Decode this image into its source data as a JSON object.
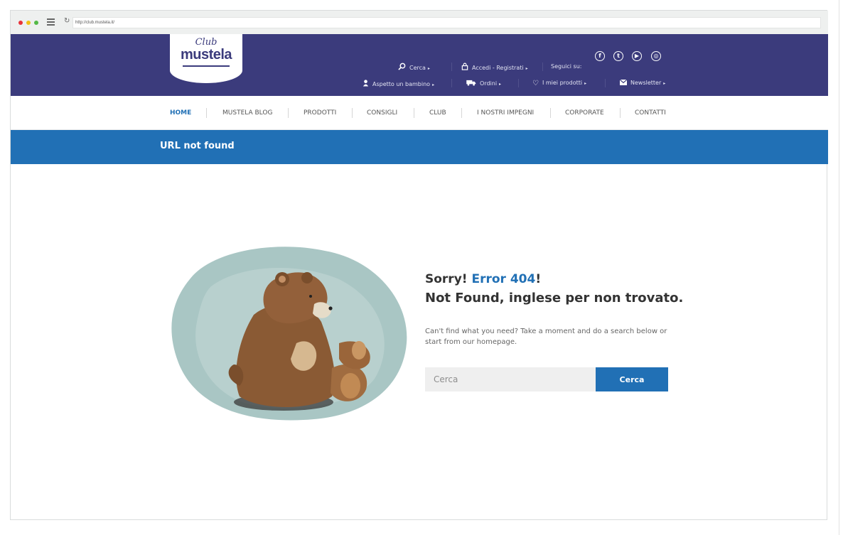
{
  "browser": {
    "url": "http://club.mustela.it/"
  },
  "logo": {
    "club": "Club",
    "name": "mustela"
  },
  "header": {
    "search_label": "Cerca",
    "login_label": "Accedi - Registrati",
    "follow_label": "Seguici su:",
    "expecting_label": "Aspetto un bambino",
    "orders_label": "Ordini",
    "my_products_label": "I miei prodotti",
    "newsletter_label": "Newsletter"
  },
  "social": [
    "facebook-icon",
    "twitter-icon",
    "youtube-icon",
    "instagram-icon"
  ],
  "nav": {
    "items": [
      {
        "label": "HOME"
      },
      {
        "label": "MUSTELA BLOG"
      },
      {
        "label": "PRODOTTI"
      },
      {
        "label": "CONSIGLI"
      },
      {
        "label": "CLUB"
      },
      {
        "label": "I NOSTRI IMPEGNI"
      },
      {
        "label": "CORPORATE"
      },
      {
        "label": "CONTATTI"
      }
    ]
  },
  "banner": {
    "title": "URL not found"
  },
  "error": {
    "sorry": "Sorry!",
    "code": "Error 404",
    "excl": "!",
    "subtitle": "Not Found, inglese per non trovato.",
    "description": "Can't find what you need? Take a moment and do a search below or start from our homepage."
  },
  "search": {
    "placeholder": "Cerca",
    "button_label": "Cerca"
  },
  "colors": {
    "header": "#3b3b7c",
    "accent": "#2170b5",
    "nav_active": "#2170b5"
  }
}
